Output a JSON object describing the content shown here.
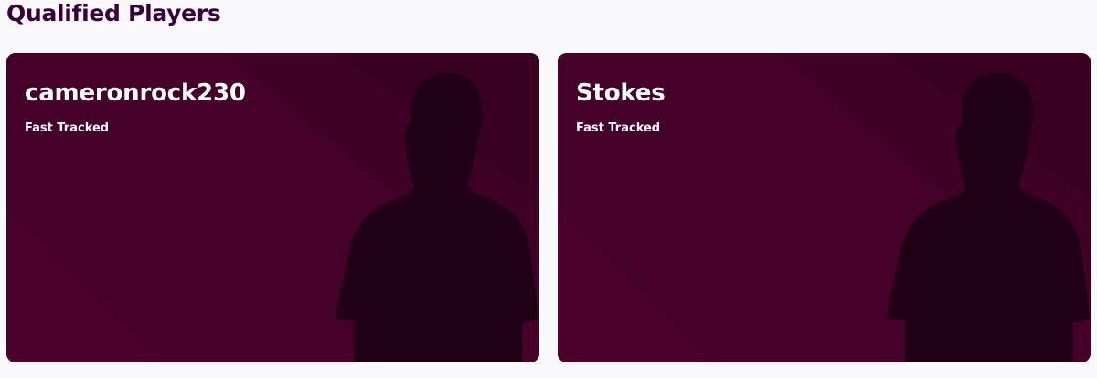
{
  "section": {
    "title": "Qualified Players"
  },
  "players": [
    {
      "name": "cameronrock230",
      "status": "Fast Tracked"
    },
    {
      "name": "Stokes",
      "status": "Fast Tracked"
    }
  ],
  "colors": {
    "title": "#37003c",
    "card_background": "#46012a",
    "card_stripe": "#3a0022",
    "silhouette": "#200014",
    "text": "#ffffff"
  },
  "icons": {
    "player_placeholder": "player-silhouette-icon"
  }
}
